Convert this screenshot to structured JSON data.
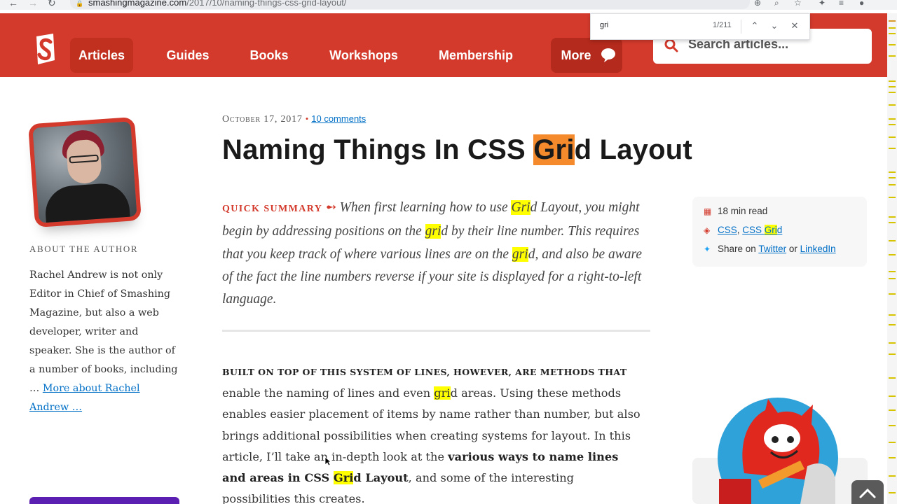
{
  "browser": {
    "url_host": "smashingmagazine.com",
    "url_path": "/2017/10/naming-things-css-grid-layout/"
  },
  "findbar": {
    "query": "gri",
    "count": "1/211"
  },
  "nav": {
    "items": [
      "Articles",
      "Guides",
      "Books",
      "Workshops",
      "Membership"
    ],
    "more_label": "More",
    "search_placeholder": "Search articles..."
  },
  "author": {
    "about_label": "ABOUT THE AUTHOR",
    "bio_text": "Rachel Andrew is not only Editor in Chief of Smashing Magazine, but also a web developer, writer and speaker. She is the author of a number of books, including … ",
    "more_link": "More about Rachel Andrew …"
  },
  "article": {
    "date": "October 17, 2017",
    "comments": "10 comments",
    "title_pre": "Naming Things In CSS ",
    "title_match": "Gri",
    "title_post": "d Layout",
    "summary_label": "QUICK SUMMARY",
    "summary_1": "When first learning how to use ",
    "summary_m1": "Gri",
    "summary_2": "d Layout, you might begin by addressing positions on the ",
    "summary_m2": "gri",
    "summary_3": "d by their line number. This requires that you keep track of where various lines are on the ",
    "summary_m3": "gri",
    "summary_4": "d, and also be aware of the fact the line numbers reverse if your site is displayed for a right-to-left language.",
    "lead_caps": "BUILT ON TOP OF THIS SYSTEM OF LINES, HOWEVER, ARE METHODS THAT",
    "lead_1": " enable the naming of lines and even ",
    "lead_m1": "gri",
    "lead_2": "d areas. Using these methods enables easier placement of items by name rather than number, but also brings additional possibilities when creating systems for layout. In this article, I’ll take an in-depth look at the ",
    "lead_bold1": "various ways to name lines and areas in CSS ",
    "lead_m2": "Gri",
    "lead_bold2": "d Layout",
    "lead_3": ", and some of the interesting possibilities this creates."
  },
  "info": {
    "read_time": "18 min read",
    "tag1": "CSS",
    "tag_sep": ", ",
    "tag2_pre": "CSS ",
    "tag2_match": "Gri",
    "tag2_post": "d",
    "share_label": "Share on ",
    "twitter": "Twitter",
    "or": " or ",
    "linkedin": "LinkedIn"
  },
  "colors": {
    "brand_red": "#d33a2c",
    "link_blue": "#006fc6",
    "highlight": "#ffff00",
    "current_match": "#f48a2b"
  }
}
